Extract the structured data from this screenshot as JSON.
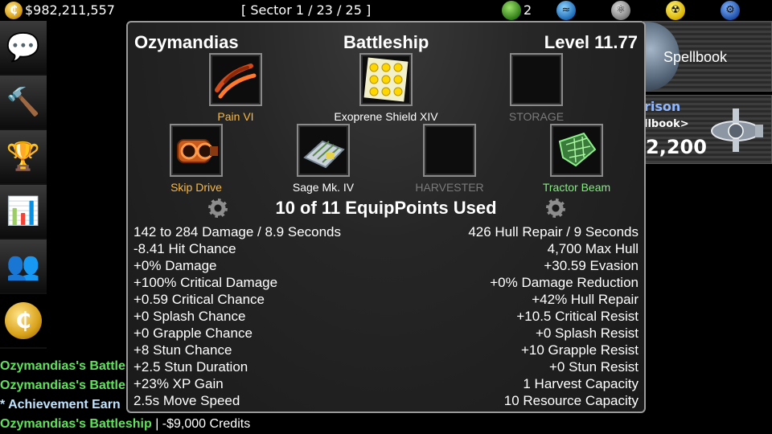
{
  "topbar": {
    "coin_glyph": "₵",
    "credits": "$982,211,557",
    "sector": "[ Sector 1 / 23 / 25 ]",
    "leaf_count": "2",
    "resource_icons": [
      "leaf-icon",
      "water-icon",
      "atom-icon",
      "radiation-icon",
      "gear-icon"
    ]
  },
  "sidebar": {
    "items": [
      {
        "icon": "chat-icon",
        "glyph": "💬"
      },
      {
        "icon": "gavel-icon",
        "glyph": "🔨"
      },
      {
        "icon": "trophy-icon",
        "glyph": "🏆"
      },
      {
        "icon": "bar-chart-icon",
        "glyph": "📊"
      },
      {
        "icon": "group-icon",
        "glyph": "👥"
      },
      {
        "icon": "coin-icon",
        "glyph": "₵"
      }
    ]
  },
  "right_panel": {
    "spellbook_label": "Spellbook",
    "card_name": "rison",
    "card_sub": "llbook>",
    "card_number": "2,200"
  },
  "modal": {
    "ship_name": "Ozymandias",
    "ship_class": "Battleship",
    "level": "Level 11.77",
    "slots": [
      {
        "label": "Pain VI",
        "color": "orange",
        "icon": "weapon-icon"
      },
      {
        "label": "Exoprene Shield XIV",
        "color": "white",
        "icon": "shield-icon"
      },
      {
        "label": "STORAGE",
        "color": "grey",
        "icon": "empty"
      },
      {
        "label": "Skip Drive",
        "color": "orange",
        "icon": "engine-icon"
      },
      {
        "label": "Sage Mk. IV",
        "color": "white",
        "icon": "computer-icon"
      },
      {
        "label": "HARVESTER",
        "color": "grey",
        "icon": "empty"
      },
      {
        "label": "Tractor Beam",
        "color": "green",
        "icon": "tractor-beam-icon"
      }
    ],
    "equip_points": "10 of 11 EquipPoints Used",
    "stats_left": [
      "142 to 284 Damage / 8.9 Seconds",
      "-8.41 Hit Chance",
      "+0% Damage",
      "+100% Critical Damage",
      "+0.59 Critical Chance",
      "+0 Splash Chance",
      "+0 Grapple Chance",
      "+8 Stun Chance",
      "+2.5 Stun Duration",
      "+23% XP Gain",
      "2.5s Move Speed"
    ],
    "stats_right": [
      "426 Hull Repair / 9 Seconds",
      "4,700 Max Hull",
      "+30.59 Evasion",
      "+0% Damage Reduction",
      "+42% Hull Repair",
      "+10.5 Critical Resist",
      "+0 Splash Resist",
      "+10 Grapple Resist",
      "+0 Stun Resist",
      "1 Harvest Capacity",
      "10 Resource Capacity"
    ]
  },
  "chat": [
    {
      "name": "Ozymandias's Battle",
      "text": ""
    },
    {
      "name": "Ozymandias's Battle",
      "text": ""
    },
    {
      "name": "* Achievement Earn",
      "text": ""
    },
    {
      "name": "Ozymandias's Battleship",
      "text": " | -$9,000 Credits"
    }
  ],
  "colors": {
    "orange": "#ffb838",
    "green": "#7ef07a",
    "grey": "#7a7a7a",
    "chat_green": "#5fe35a",
    "chat_cyan": "#bfe4ff"
  }
}
